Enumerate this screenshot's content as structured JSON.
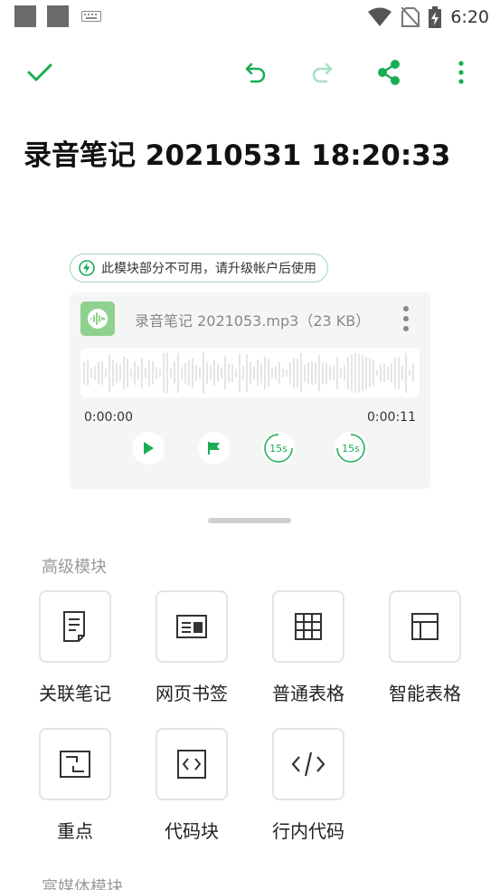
{
  "status_bar": {
    "time": "6:20"
  },
  "note": {
    "title": "录音笔记 20210531 18:20:33"
  },
  "upgrade_notice": {
    "text": "此模块部分不可用，请升级帐户后使用"
  },
  "audio": {
    "file_name": "录音笔记 2021053.mp3（23 KB）",
    "current_time": "0:00:00",
    "duration": "0:00:11",
    "skip_back_label": "15s",
    "skip_forward_label": "15s"
  },
  "advanced_modules": {
    "title": "高级模块",
    "items": [
      {
        "label": "关联笔记",
        "icon": "linked-note-icon"
      },
      {
        "label": "网页书签",
        "icon": "web-bookmark-icon"
      },
      {
        "label": "普通表格",
        "icon": "table-icon"
      },
      {
        "label": "智能表格",
        "icon": "smart-table-icon"
      },
      {
        "label": "重点",
        "icon": "highlight-icon"
      },
      {
        "label": "代码块",
        "icon": "code-block-icon"
      },
      {
        "label": "行内代码",
        "icon": "inline-code-icon"
      }
    ]
  },
  "rich_media_modules": {
    "title": "富媒体模块"
  },
  "colors": {
    "accent": "#1aad54",
    "accent_light": "#9bd8b2",
    "file_icon": "#8fd18f"
  }
}
